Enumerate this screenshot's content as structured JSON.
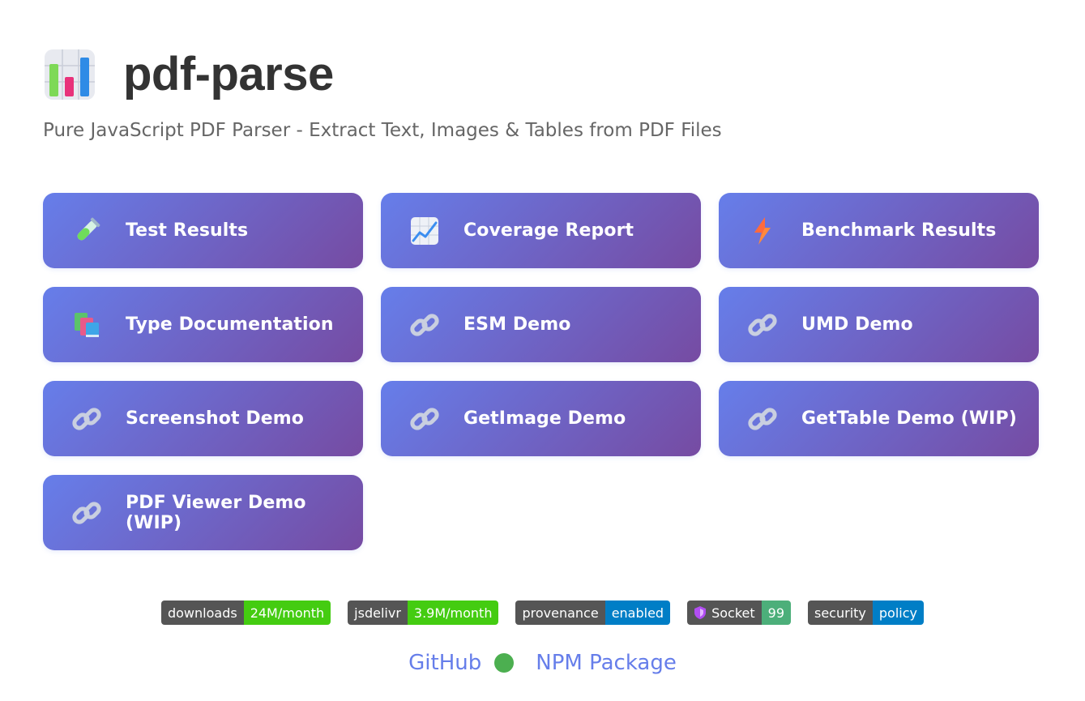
{
  "header": {
    "title": "pdf-parse",
    "subtitle": "Pure JavaScript PDF Parser - Extract Text, Images & Tables from PDF Files",
    "logo_icon": "bar-chart-icon"
  },
  "cards": [
    {
      "label": "Test Results",
      "icon": "test-tube-icon"
    },
    {
      "label": "Coverage Report",
      "icon": "line-chart-icon"
    },
    {
      "label": "Benchmark Results",
      "icon": "lightning-icon"
    },
    {
      "label": "Type Documentation",
      "icon": "books-icon"
    },
    {
      "label": "ESM Demo",
      "icon": "link-icon"
    },
    {
      "label": "UMD Demo",
      "icon": "link-icon"
    },
    {
      "label": "Screenshot Demo",
      "icon": "link-icon"
    },
    {
      "label": "GetImage Demo",
      "icon": "link-icon"
    },
    {
      "label": "GetTable Demo (WIP)",
      "icon": "link-icon"
    },
    {
      "label": "PDF Viewer Demo (WIP)",
      "icon": "link-icon"
    }
  ],
  "badges": [
    {
      "left": "downloads",
      "right": "24M/month",
      "color": "#44cc11"
    },
    {
      "left": "jsdelivr",
      "right": "3.9M/month",
      "color": "#44cc11"
    },
    {
      "left": "provenance",
      "right": "enabled",
      "color": "#007ec6"
    },
    {
      "left": "Socket",
      "right": "99",
      "color": "#4caf7a"
    },
    {
      "left": "security",
      "right": "policy",
      "color": "#007ec6"
    }
  ],
  "footer": {
    "github": "GitHub",
    "npm": "NPM Package"
  },
  "colors": {
    "gradient_start": "#667eea",
    "gradient_end": "#764ba2",
    "link": "#667eea",
    "status_dot": "#4caf50"
  }
}
